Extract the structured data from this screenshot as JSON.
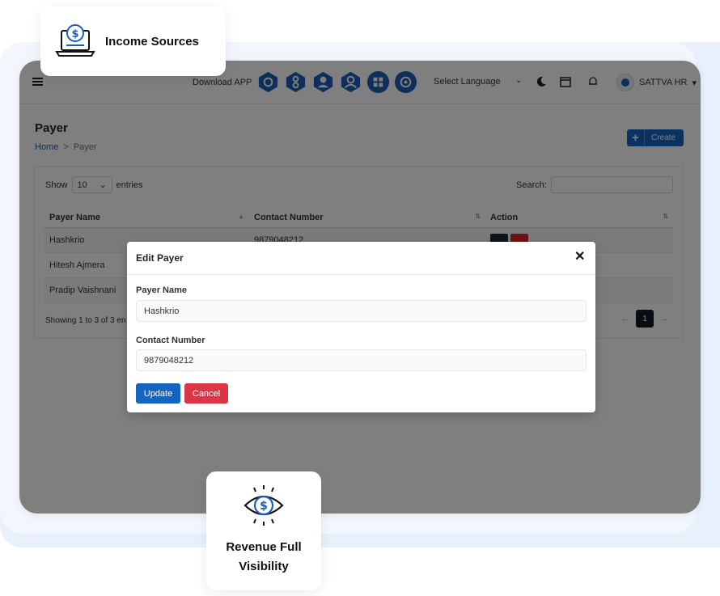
{
  "callouts": {
    "top_label": "Income Sources",
    "bottom_label_line1": "Revenue Full",
    "bottom_label_line2": "Visibility"
  },
  "header": {
    "download_label": "Download APP",
    "app_icons": [
      "app-cube-icon",
      "app-dna-icon",
      "user-shield-icon",
      "user-group-icon",
      "grid-icon",
      "support-icon"
    ],
    "language_label": "Select Language",
    "company_name": "SATTVA HR",
    "accent_color": "#1a5fb4"
  },
  "page": {
    "title": "Payer",
    "breadcrumb_home": "Home",
    "breadcrumb_sep": ">",
    "breadcrumb_current": "Payer",
    "create_label": "Create"
  },
  "table_controls": {
    "show_label": "Show",
    "entries_value": "10",
    "entries_label": "entries",
    "search_label": "Search:"
  },
  "table": {
    "headers": [
      "Payer Name",
      "Contact Number",
      "Action"
    ],
    "rows": [
      {
        "name": "Hashkrio",
        "contact": "9879048212"
      },
      {
        "name": "Hitesh Ajmera",
        "contact": ""
      },
      {
        "name": "Pradip Vaishnani",
        "contact": ""
      }
    ],
    "showing_info": "Showing 1 to 3 of 3 en",
    "current_page": "1"
  },
  "modal": {
    "title": "Edit Payer",
    "close_symbol": "✕",
    "payer_name_label": "Payer Name",
    "payer_name_value": "Hashkrio",
    "contact_label": "Contact Number",
    "contact_value": "9879048212",
    "update_label": "Update",
    "cancel_label": "Cancel"
  }
}
